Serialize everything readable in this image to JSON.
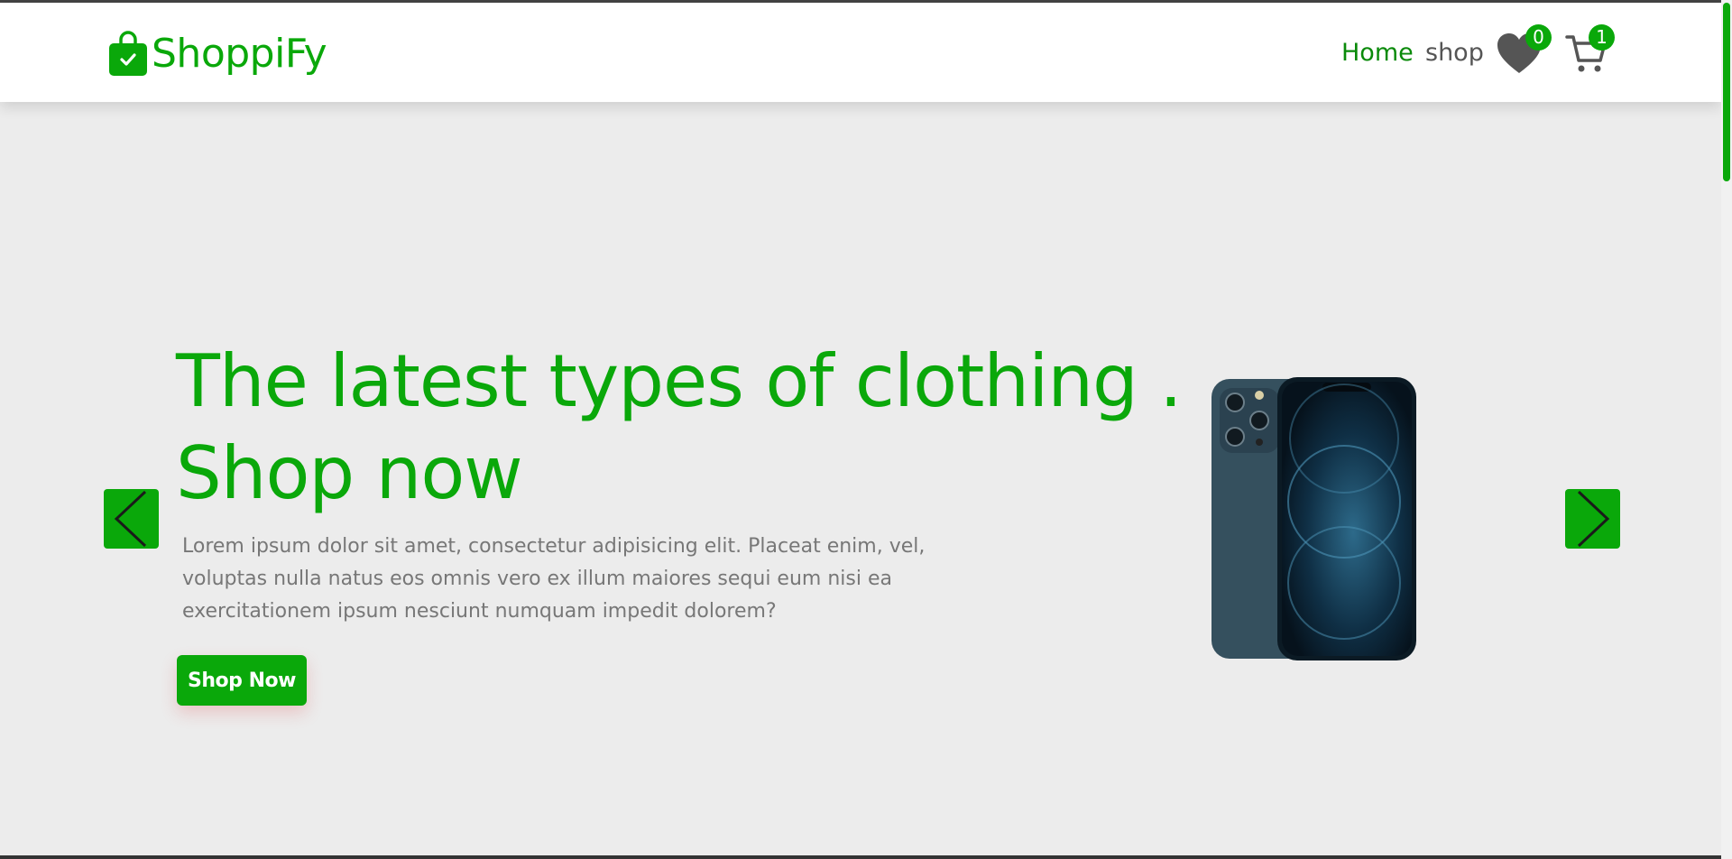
{
  "brand": {
    "name": "ShoppiFy",
    "icon": "shopping-bag-check-icon",
    "color": "#0aa80a"
  },
  "nav": {
    "home_label": "Home",
    "shop_label": "shop",
    "wishlist": {
      "icon": "heart-icon",
      "count": "0"
    },
    "cart": {
      "icon": "cart-icon",
      "count": "1"
    }
  },
  "hero": {
    "title_line1": "The latest types of clothing .",
    "title_line2": "Shop now",
    "description": "Lorem ipsum dolor sit amet, consectetur adipisicing elit. Placeat enim, vel, voluptas nulla natus eos omnis vero ex illum maiores sequi eum nisi ea exercitationem ipsum nesciunt numquam impedit dolorem?",
    "cta_label": "Shop Now",
    "image": "smartphone-image"
  },
  "slider": {
    "prev_icon": "chevron-left-icon",
    "next_icon": "chevron-right-icon"
  },
  "colors": {
    "accent": "#0aa80a",
    "background": "#ececec",
    "navbar": "#ffffff"
  }
}
